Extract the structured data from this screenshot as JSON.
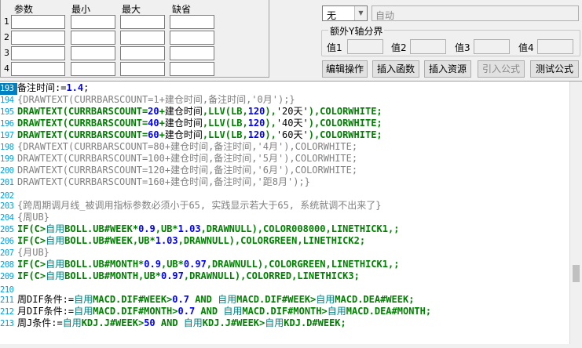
{
  "params": {
    "headers": [
      "参数",
      "最小",
      "最大",
      "缺省"
    ],
    "rows": [
      "1",
      "2",
      "3",
      "4"
    ]
  },
  "right": {
    "select_value": "无",
    "auto_field": "自动",
    "group_title": "额外Y轴分界",
    "value_labels": [
      "值1",
      "值2",
      "值3",
      "值4"
    ],
    "buttons": [
      "编辑操作",
      "插入函数",
      "插入资源",
      "引入公式",
      "测试公式"
    ]
  },
  "colors": {
    "blue": "#0000ff",
    "green": "#008000",
    "gray": "#808080",
    "teal": "#008080",
    "olive": "#808000",
    "navy": "#000080"
  },
  "editor": {
    "lines": [
      {
        "num": "193",
        "current": true,
        "segs": [
          [
            "备注时间:=",
            "k"
          ],
          [
            "1.4",
            "num"
          ],
          [
            ";",
            "k"
          ]
        ]
      },
      {
        "num": "194",
        "segs": [
          [
            "{DRAWTEXT(CURRBARSCOUNT=1+建仓时间,备注时间,'0月');}",
            "cmt"
          ]
        ]
      },
      {
        "num": "195",
        "segs": [
          [
            "DRAWTEXT(CURRBARSCOUNT=",
            "fn"
          ],
          [
            "20",
            "num"
          ],
          [
            "+",
            "fn"
          ],
          [
            "建仓时间",
            "k"
          ],
          [
            ",",
            "fn"
          ],
          [
            "LLV(LB,",
            "fn"
          ],
          [
            "120",
            "num"
          ],
          [
            "),",
            "fn"
          ],
          [
            "'20天'",
            "k"
          ],
          [
            "),COLORWHITE;",
            "fn"
          ]
        ]
      },
      {
        "num": "196",
        "segs": [
          [
            "DRAWTEXT(CURRBARSCOUNT=",
            "fn"
          ],
          [
            "40",
            "num"
          ],
          [
            "+",
            "fn"
          ],
          [
            "建仓时间",
            "k"
          ],
          [
            ",",
            "fn"
          ],
          [
            "LLV(LB,",
            "fn"
          ],
          [
            "120",
            "num"
          ],
          [
            "),",
            "fn"
          ],
          [
            "'40天'",
            "k"
          ],
          [
            "),COLORWHITE;",
            "fn"
          ]
        ]
      },
      {
        "num": "197",
        "segs": [
          [
            "DRAWTEXT(CURRBARSCOUNT=",
            "fn"
          ],
          [
            "60",
            "num"
          ],
          [
            "+",
            "fn"
          ],
          [
            "建仓时间",
            "k"
          ],
          [
            ",",
            "fn"
          ],
          [
            "LLV(LB,",
            "fn"
          ],
          [
            "120",
            "num"
          ],
          [
            "),",
            "fn"
          ],
          [
            "'60天'",
            "k"
          ],
          [
            "),COLORWHITE;",
            "fn"
          ]
        ]
      },
      {
        "num": "198",
        "segs": [
          [
            "{DRAWTEXT(CURRBARSCOUNT=80+建仓时间,备注时间,'4月'),COLORWHITE;",
            "cmt"
          ]
        ]
      },
      {
        "num": "199",
        "segs": [
          [
            "DRAWTEXT(CURRBARSCOUNT=100+建仓时间,备注时间,'5月'),COLORWHITE;",
            "cmt"
          ]
        ]
      },
      {
        "num": "200",
        "segs": [
          [
            "DRAWTEXT(CURRBARSCOUNT=120+建仓时间,备注时间,'6月'),COLORWHITE;",
            "cmt"
          ]
        ]
      },
      {
        "num": "201",
        "segs": [
          [
            "DRAWTEXT(CURRBARSCOUNT=160+建仓时间,备注时间,'距8月');}",
            "cmt"
          ]
        ]
      },
      {
        "num": "202",
        "segs": []
      },
      {
        "num": "203",
        "segs": [
          [
            "{跨周期调月线_被调用指标参数必须小于65, 实践显示若大于65, 系统就调不出来了}",
            "cmt"
          ]
        ]
      },
      {
        "num": "204",
        "segs": [
          [
            "{周UB}",
            "cmt"
          ]
        ]
      },
      {
        "num": "205",
        "segs": [
          [
            "IF(C>",
            "fn"
          ],
          [
            "自用",
            "kw"
          ],
          [
            "BOLL.UB#WEEK*",
            "fn"
          ],
          [
            "0.9",
            "num"
          ],
          [
            ",UB*",
            "fn"
          ],
          [
            "1.03",
            "num"
          ],
          [
            ",DRAWNULL),COLOR008000,LINETHICK1,;",
            "fn"
          ]
        ]
      },
      {
        "num": "206",
        "segs": [
          [
            "IF(C>",
            "fn"
          ],
          [
            "自用",
            "kw"
          ],
          [
            "BOLL.UB#WEEK,UB*",
            "fn"
          ],
          [
            "1.03",
            "num"
          ],
          [
            ",DRAWNULL),COLORGREEN,LINETHICK2;",
            "fn"
          ]
        ]
      },
      {
        "num": "207",
        "segs": [
          [
            "{月UB}",
            "cmt"
          ]
        ]
      },
      {
        "num": "208",
        "segs": [
          [
            "IF(C>",
            "fn"
          ],
          [
            "自用",
            "kw"
          ],
          [
            "BOLL.UB#MONTH*",
            "fn"
          ],
          [
            "0.9",
            "num"
          ],
          [
            ",UB*",
            "fn"
          ],
          [
            "0.97",
            "num"
          ],
          [
            ",DRAWNULL),COLORGREEN,LINETHICK1,;",
            "fn"
          ]
        ]
      },
      {
        "num": "209",
        "segs": [
          [
            "IF(C>",
            "fn"
          ],
          [
            "自用",
            "kw"
          ],
          [
            "BOLL.UB#MONTH,UB*",
            "fn"
          ],
          [
            "0.97",
            "num"
          ],
          [
            ",DRAWNULL),COLORRED,LINETHICK3;",
            "fn"
          ]
        ]
      },
      {
        "num": "210",
        "segs": []
      },
      {
        "num": "211",
        "segs": [
          [
            "周DIF条件:=",
            "k"
          ],
          [
            "自用",
            "kw"
          ],
          [
            "MACD.DIF#WEEK>",
            "fn"
          ],
          [
            "0.7",
            "num"
          ],
          [
            " AND ",
            "fn"
          ],
          [
            "自用",
            "kw"
          ],
          [
            "MACD.DIF#WEEK>",
            "fn"
          ],
          [
            "自用",
            "kw"
          ],
          [
            "MACD.DEA#WEEK;",
            "fn"
          ]
        ]
      },
      {
        "num": "212",
        "segs": [
          [
            "月DIF条件:=",
            "k"
          ],
          [
            "自用",
            "kw"
          ],
          [
            "MACD.DIF#MONTH>",
            "fn"
          ],
          [
            "0.7",
            "num"
          ],
          [
            " AND ",
            "fn"
          ],
          [
            "自用",
            "kw"
          ],
          [
            "MACD.DIF#MONTH>",
            "fn"
          ],
          [
            "自用",
            "kw"
          ],
          [
            "MACD.DEA#MONTH;",
            "fn"
          ]
        ]
      },
      {
        "num": "213",
        "segs": [
          [
            "周J条件:=",
            "k"
          ],
          [
            "自用",
            "kw"
          ],
          [
            "KDJ.J#WEEK>",
            "fn"
          ],
          [
            "50",
            "num"
          ],
          [
            " AND ",
            "fn"
          ],
          [
            "自用",
            "kw"
          ],
          [
            "KDJ.J#WEEK>",
            "fn"
          ],
          [
            "自用",
            "kw"
          ],
          [
            "KDJ.D#WEEK;",
            "fn"
          ]
        ]
      }
    ]
  }
}
